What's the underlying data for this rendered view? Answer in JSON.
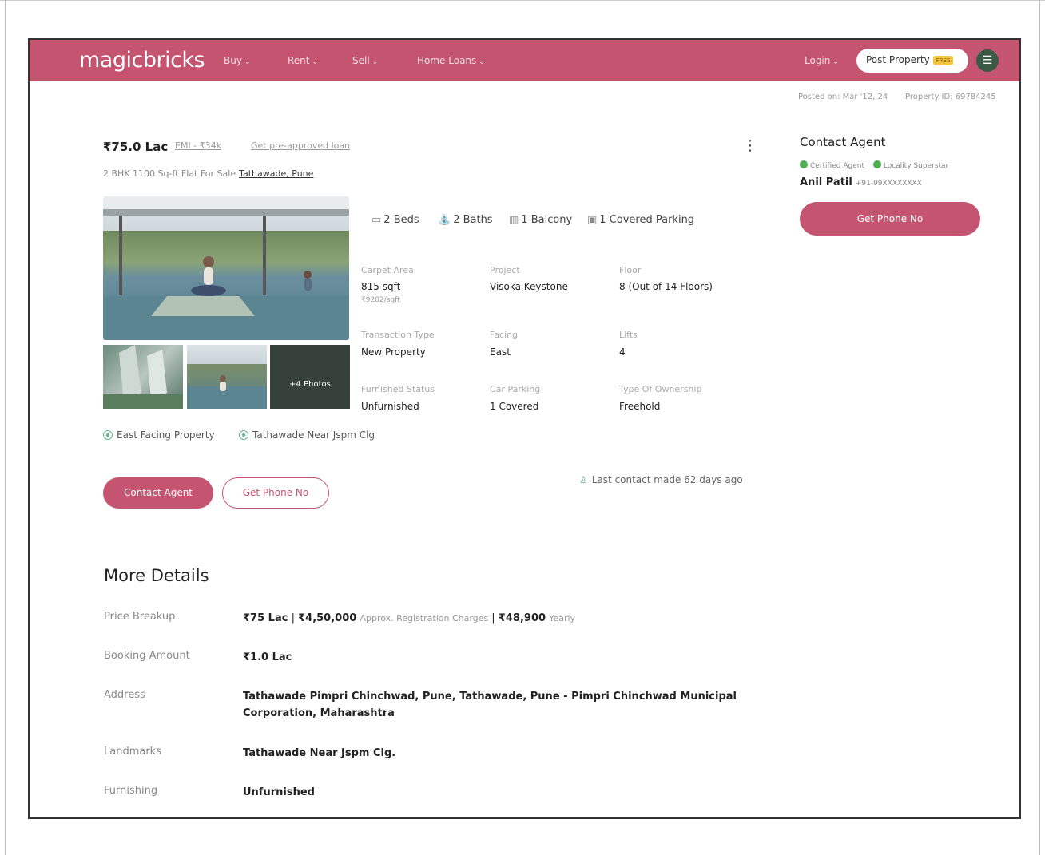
{
  "nav": {
    "logo": "magicbricks",
    "items": [
      "Buy",
      "Rent",
      "Sell",
      "Home Loans"
    ],
    "login": "Login",
    "post_property": "Post Property",
    "free_badge": "FREE",
    "brand_color": "#c4546f"
  },
  "meta": {
    "posted": "Posted on: Mar '12, 24",
    "property_id": "Property ID: 69784245"
  },
  "listing": {
    "price": "₹75.0 Lac",
    "emi": "EMI - ₹34k",
    "preapproved": "Get pre-approved loan",
    "subtitle": "2 BHK 1100 Sq-ft Flat For Sale",
    "location": "Tathawade, Pune",
    "more_photos": "+4 Photos",
    "amenities": [
      "2 Beds",
      "2 Baths",
      "1 Balcony",
      "1 Covered Parking"
    ],
    "facts": {
      "carpet_area": {
        "label": "Carpet Area",
        "value": "815 sqft",
        "sub": "₹9202/sqft"
      },
      "project": {
        "label": "Project",
        "value": "Visoka Keystone"
      },
      "floor": {
        "label": "Floor",
        "value": "8 (Out of 14 Floors)"
      },
      "transaction": {
        "label": "Transaction Type",
        "value": "New Property"
      },
      "facing": {
        "label": "Facing",
        "value": "East"
      },
      "lifts": {
        "label": "Lifts",
        "value": "4"
      },
      "furnished": {
        "label": "Furnished Status",
        "value": "Unfurnished"
      },
      "car_parking": {
        "label": "Car Parking",
        "value": "1 Covered"
      },
      "ownership": {
        "label": "Type Of Ownership",
        "value": "Freehold"
      }
    },
    "tags": [
      "East Facing Property",
      "Tathawade Near Jspm Clg"
    ],
    "contact_agent_btn": "Contact Agent",
    "get_phone_btn": "Get Phone No",
    "last_contact": "Last contact made 62 days ago"
  },
  "agent": {
    "title": "Contact Agent",
    "badge_certified": "Certified Agent",
    "badge_locality": "Locality Superstar",
    "name": "Anil Patil",
    "phone": "+91-99XXXXXXXX",
    "get_phone_btn": "Get Phone No"
  },
  "more_details": {
    "title": "More Details",
    "price_breakup": {
      "label": "Price Breakup",
      "price": "₹75 Lac",
      "sep1": "|",
      "registration_amount": "₹4,50,000",
      "registration_label": "Approx. Registration Charges",
      "sep2": "|",
      "maintenance": "₹48,900",
      "maintenance_label": "Yearly"
    },
    "booking": {
      "label": "Booking Amount",
      "value": "₹1.0 Lac"
    },
    "address": {
      "label": "Address",
      "value": "Tathawade Pimpri Chinchwad, Pune, Tathawade, Pune - Pimpri Chinchwad Municipal Corporation, Maharashtra"
    },
    "landmarks": {
      "label": "Landmarks",
      "value": "Tathawade Near Jspm Clg."
    },
    "furnishing": {
      "label": "Furnishing",
      "value": "Unfurnished"
    }
  }
}
